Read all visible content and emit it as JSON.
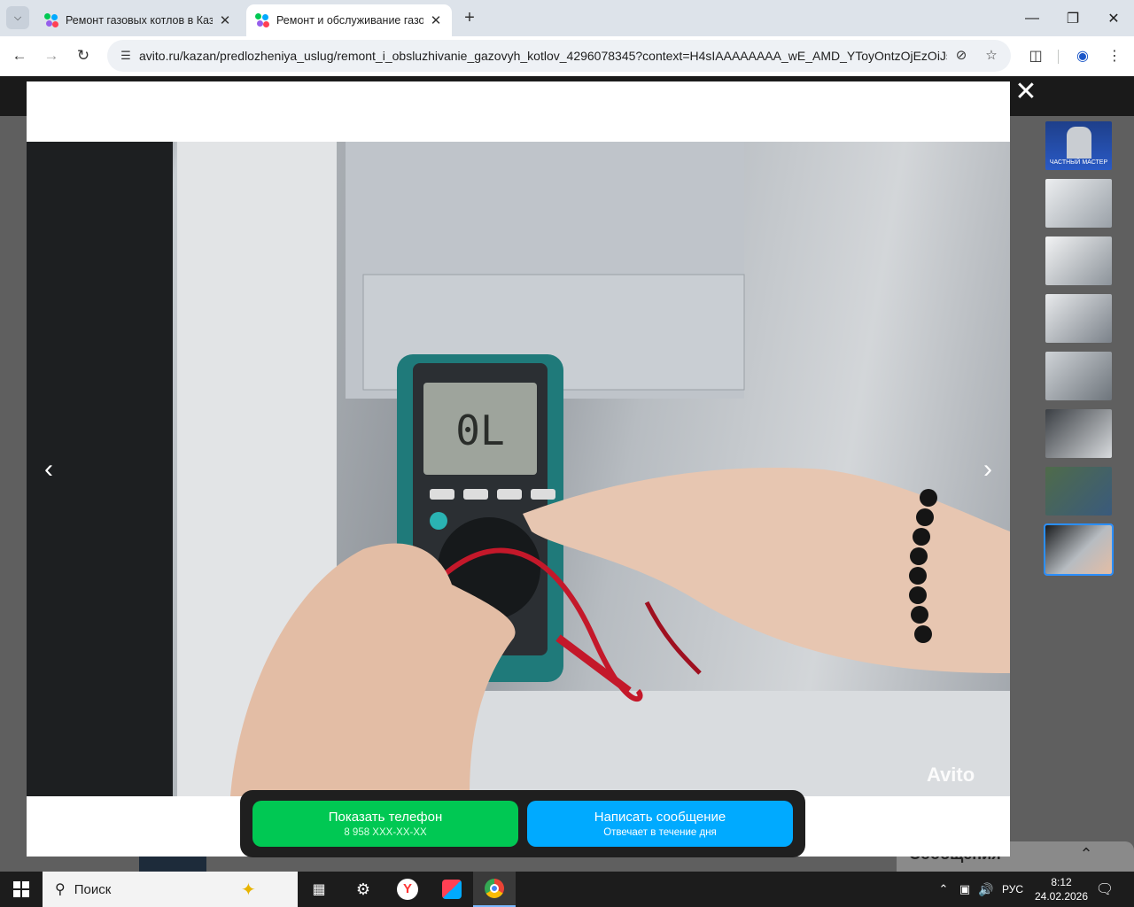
{
  "browser": {
    "tabs": [
      {
        "title": "Ремонт газовых котлов в Каза",
        "active": false
      },
      {
        "title": "Ремонт и обслуживание газов",
        "active": true
      }
    ],
    "url": "avito.ru/kazan/predlozheniya_uslug/remont_i_obsluzhivanie_gazovyh_kotlov_4296078345?context=H4sIAAAAAAAA_wE_AMD_YToyOntzOjEzOiJsb..."
  },
  "lightbox": {
    "watermark": "Avito",
    "thumbnail_count": 8,
    "selected_thumbnail": 8,
    "first_thumb_caption": "ЧАСТНЫЙ МАСТЕР"
  },
  "cta": {
    "phone_label": "Показать телефон",
    "phone_masked": "8 958 XXX-XX-XX",
    "message_label": "Написать сообщение",
    "message_sub": "Отвечает в течение дня"
  },
  "page_behind": {
    "messages_label": "Сообщения"
  },
  "taskbar": {
    "search_placeholder": "Поиск",
    "lang": "РУС",
    "time": "8:12",
    "date": "24.02.2026"
  },
  "colors": {
    "phone_button": "#00c853",
    "message_button": "#00aaff",
    "thumb_selected_outline": "#2b8fff"
  }
}
